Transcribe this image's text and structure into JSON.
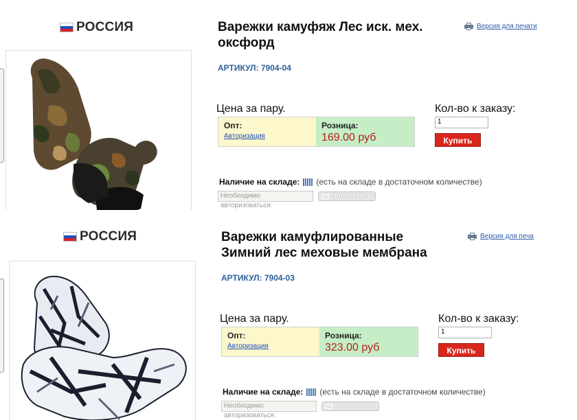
{
  "products": [
    {
      "country": "РОССИЯ",
      "title_lines": [
        "Варежки камуфяж Лес иск. мех.",
        "оксфорд"
      ],
      "print_link": "Версия для печати",
      "sku": "АРТИКУЛ: 7904-04",
      "price_label": "Цена за пару.",
      "wholesale": {
        "label": "Опт:",
        "link": "Авторизация"
      },
      "retail": {
        "label": "Розница:",
        "price": "169.00 руб"
      },
      "qty_label": "Кол-во к заказу:",
      "qty_value": "1",
      "buy_label": "Купить",
      "stock_label": "Наличие на складе:",
      "stock_note": "(есть на складе в достаточном количестве)",
      "auth_note": "Необходимо авторизоваться:",
      "notify_label": "Оповестить",
      "image_icon": "camo-forest-mittens-photo"
    },
    {
      "country": "РОССИЯ",
      "title_lines": [
        "Варежки камуфлированные",
        "Зимний лес меховые мембрана"
      ],
      "print_link": "Версия для печа",
      "sku": "АРТИКУЛ: 7904-03",
      "price_label": "Цена за пару.",
      "wholesale": {
        "label": "Опт:",
        "link": "Авторизация"
      },
      "retail": {
        "label": "Розница:",
        "price": "323.00 руб"
      },
      "qty_label": "Кол-во к заказу:",
      "qty_value": "1",
      "buy_label": "Купить",
      "stock_label": "Наличие на складе:",
      "stock_note": "(есть на складе в достаточном количестве)",
      "auth_note": "Необходимо авторизоваться:",
      "notify_label": "Оповестить",
      "image_icon": "camo-winter-mittens-photo"
    }
  ],
  "colors": {
    "sku": "#2d5f99",
    "price": "#b51e1e",
    "wholesale_bg": "#fdf7cc",
    "retail_bg": "#c5eec6",
    "buy_button": "#d9261c",
    "link": "#1f4fbf"
  }
}
